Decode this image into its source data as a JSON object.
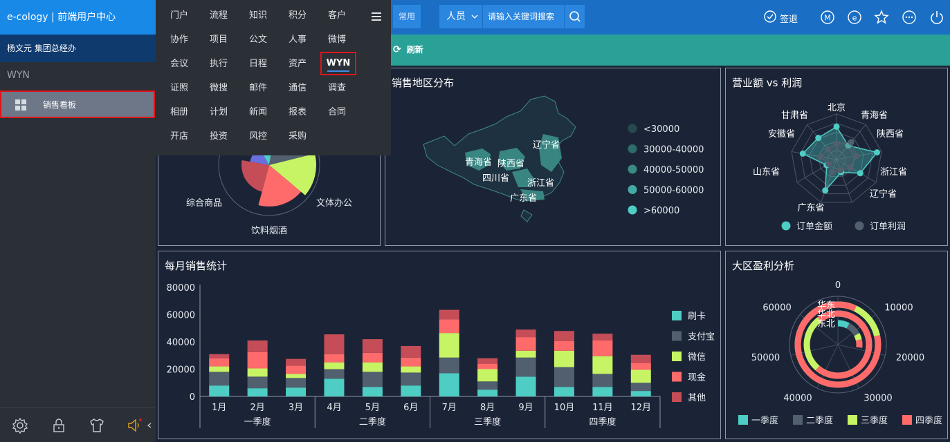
{
  "header": {
    "brand": "e-cology | 前端用户中心",
    "user": "杨文元  集团总经办",
    "common_tab": "常用",
    "search_category": "人员",
    "search_placeholder": "请输入关键词搜索",
    "signout": "签退"
  },
  "sidebar": {
    "section": "WYN",
    "items": [
      {
        "label": "销售看板",
        "icon": "grid-icon"
      }
    ]
  },
  "menu": {
    "items": [
      "门户",
      "流程",
      "知识",
      "积分",
      "客户",
      "协作",
      "项目",
      "公文",
      "人事",
      "微博",
      "会议",
      "执行",
      "日程",
      "资产",
      "WYN",
      "证照",
      "微搜",
      "邮件",
      "通信",
      "调查",
      "相册",
      "计划",
      "新闻",
      "报表",
      "合同",
      "开店",
      "投资",
      "风控",
      "采购"
    ],
    "selected": "WYN"
  },
  "toolbar": {
    "refresh": "刷新"
  },
  "colors": {
    "teal": "#4ecdc4",
    "slate": "#525f6e",
    "lime": "#c7f464",
    "coral": "#ff6b6b",
    "red": "#c44d58"
  },
  "chart_data": [
    {
      "type": "pie",
      "title": "",
      "categories": [
        "综合商品",
        "饮料烟酒",
        "文体办公"
      ],
      "labels_visible": [
        "综合商品",
        "饮料烟酒",
        "文体办公"
      ]
    },
    {
      "type": "map",
      "title": "销售地区分布",
      "region_labels": [
        "辽宁省",
        "青海省",
        "陕西省",
        "四川省",
        "浙江省",
        "广东省"
      ],
      "legend": [
        "<30000",
        "30000-40000",
        "40000-50000",
        "50000-60000",
        ">60000"
      ],
      "legend_colors": [
        "#274a4f",
        "#2e6b6b",
        "#3a8a84",
        "#42aaa2",
        "#4ecdc4"
      ]
    },
    {
      "type": "radar",
      "title": "营业额 vs 利润",
      "indicators": [
        "北京",
        "青海省",
        "陕西省",
        "浙江省",
        "辽宁省",
        "广东省",
        "山东省",
        "安徽省",
        "甘肃省"
      ],
      "series": [
        {
          "name": "订单金额",
          "values": [
            0.72,
            0.4,
            0.9,
            0.6,
            0.3,
            0.72,
            0.25,
            0.75,
            0.62
          ]
        },
        {
          "name": "订单利润",
          "values": [
            0.35,
            0.5,
            0.45,
            0.35,
            0.25,
            0.3,
            0.2,
            0.35,
            0.3
          ]
        }
      ]
    },
    {
      "type": "bar",
      "title": "每月销售统计",
      "categories": [
        "1月",
        "2月",
        "3月",
        "4月",
        "5月",
        "6月",
        "7月",
        "8月",
        "9月",
        "10月",
        "11月",
        "12月"
      ],
      "groups": [
        "一季度",
        "二季度",
        "三季度",
        "四季度"
      ],
      "ylim": [
        0,
        80000
      ],
      "yticks": [
        0,
        20000,
        40000,
        60000,
        80000
      ],
      "series": [
        {
          "name": "刷卡",
          "values": [
            8000,
            6000,
            6500,
            13000,
            7000,
            8000,
            17000,
            5000,
            14500,
            7000,
            7000,
            4000
          ]
        },
        {
          "name": "支付宝",
          "values": [
            10000,
            8500,
            7000,
            7000,
            11000,
            9500,
            11500,
            6000,
            14000,
            14500,
            9500,
            6000
          ]
        },
        {
          "name": "微信",
          "values": [
            4000,
            6000,
            3000,
            5000,
            7000,
            4500,
            18000,
            9000,
            5000,
            12000,
            13000,
            9500
          ]
        },
        {
          "name": "现金",
          "values": [
            6000,
            12000,
            6000,
            6000,
            7000,
            6500,
            10000,
            4000,
            10000,
            7000,
            11500,
            5000
          ]
        },
        {
          "name": "其他",
          "values": [
            3000,
            8500,
            5000,
            14500,
            10000,
            8500,
            7000,
            4000,
            5500,
            7500,
            5000,
            6000
          ]
        }
      ]
    },
    {
      "type": "polar-bar",
      "title": "大区盈利分析",
      "regions": [
        "华东",
        "华北",
        "东北"
      ],
      "axis_ticks": [
        "0",
        "10000",
        "20000",
        "30000",
        "40000",
        "50000",
        "60000"
      ],
      "series": [
        {
          "name": "一季度",
          "values": [
            14000,
            10000,
            5500
          ]
        },
        {
          "name": "二季度",
          "values": [
            23000,
            18000,
            6500
          ]
        },
        {
          "name": "三季度",
          "values": [
            48000,
            35000,
            3000
          ]
        },
        {
          "name": "四季度",
          "values": [
            60000,
            50000,
            4000
          ]
        }
      ]
    }
  ]
}
